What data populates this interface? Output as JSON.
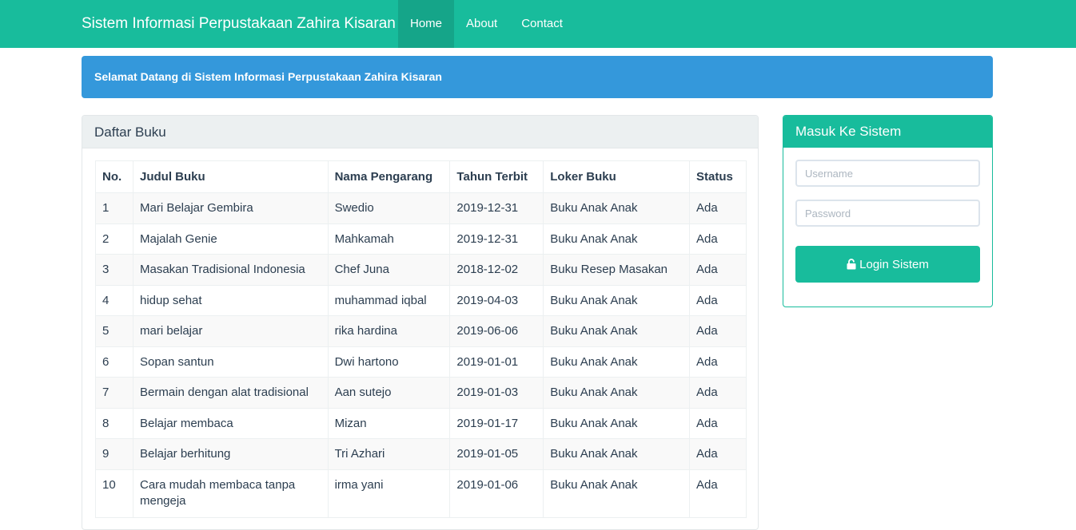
{
  "navbar": {
    "brand": "Sistem Informasi Perpustakaan Zahira Kisaran",
    "items": [
      {
        "label": "Home",
        "active": true
      },
      {
        "label": "About",
        "active": false
      },
      {
        "label": "Contact",
        "active": false
      }
    ]
  },
  "alert": {
    "text": "Selamat Datang di Sistem Informasi Perpustakaan Zahira Kisaran"
  },
  "books_panel": {
    "title": "Daftar Buku",
    "columns": [
      "No.",
      "Judul Buku",
      "Nama Pengarang",
      "Tahun Terbit",
      "Loker Buku",
      "Status"
    ],
    "rows": [
      [
        "1",
        "Mari Belajar Gembira",
        "Swedio",
        "2019-12-31",
        "Buku Anak Anak",
        "Ada"
      ],
      [
        "2",
        "Majalah Genie",
        "Mahkamah",
        "2019-12-31",
        "Buku Anak Anak",
        "Ada"
      ],
      [
        "3",
        "Masakan Tradisional Indonesia",
        "Chef Juna",
        "2018-12-02",
        "Buku Resep Masakan",
        "Ada"
      ],
      [
        "4",
        "hidup sehat",
        "muhammad iqbal",
        "2019-04-03",
        "Buku Anak Anak",
        "Ada"
      ],
      [
        "5",
        "mari belajar",
        "rika hardina",
        "2019-06-06",
        "Buku Anak Anak",
        "Ada"
      ],
      [
        "6",
        "Sopan santun",
        "Dwi hartono",
        "2019-01-01",
        "Buku Anak Anak",
        "Ada"
      ],
      [
        "7",
        "Bermain dengan alat tradisional",
        "Aan sutejo",
        "2019-01-03",
        "Buku Anak Anak",
        "Ada"
      ],
      [
        "8",
        "Belajar membaca",
        "Mizan",
        "2019-01-17",
        "Buku Anak Anak",
        "Ada"
      ],
      [
        "9",
        "Belajar berhitung",
        "Tri Azhari",
        "2019-01-05",
        "Buku Anak Anak",
        "Ada"
      ],
      [
        "10",
        "Cara mudah membaca tanpa mengeja",
        "irma yani",
        "2019-01-06",
        "Buku Anak Anak",
        "Ada"
      ]
    ]
  },
  "login_panel": {
    "title": "Masuk Ke Sistem",
    "username_placeholder": "Username",
    "password_placeholder": "Password",
    "button_label": "Login Sistem",
    "button_icon": "unlock-icon"
  },
  "colors": {
    "primary": "#18bc9c",
    "primary_active": "#15a589",
    "info": "#3498db",
    "text": "#2c3e50"
  }
}
